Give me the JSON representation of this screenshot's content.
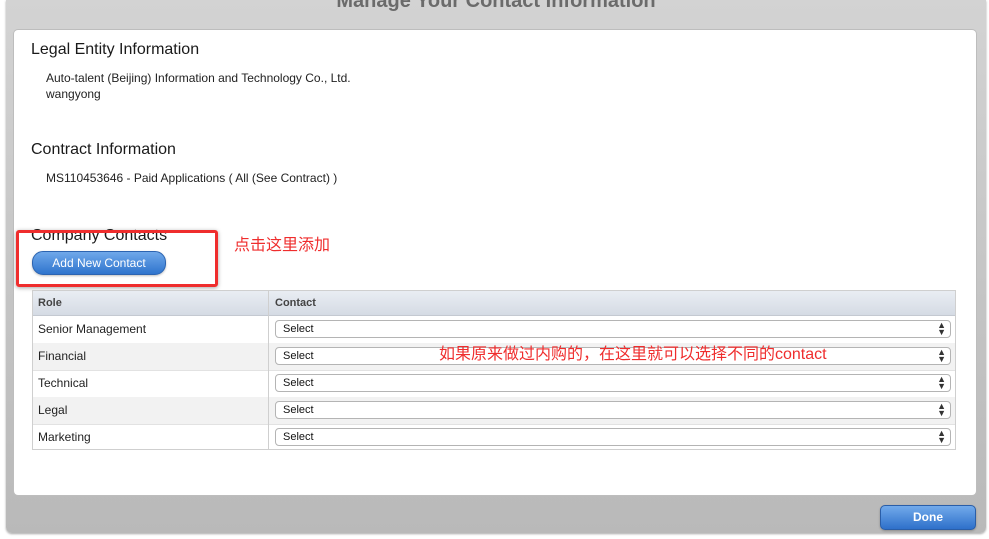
{
  "dialog": {
    "title": "Manage Your Contact Information",
    "done_label": "Done"
  },
  "legal_entity": {
    "heading": "Legal Entity Information",
    "name": "Auto-talent (Beijing) Information and Technology Co., Ltd.",
    "user": "wangyong"
  },
  "contract": {
    "heading": "Contract Information",
    "line": "MS110453646 - Paid Applications ( All (See Contract) )"
  },
  "company_contacts": {
    "heading": "Company Contacts",
    "add_label": "Add New Contact",
    "columns": [
      "Role",
      "Contact"
    ],
    "rows": [
      {
        "role": "Senior Management",
        "contact": "Select"
      },
      {
        "role": "Financial",
        "contact": "Select"
      },
      {
        "role": "Technical",
        "contact": "Select"
      },
      {
        "role": "Legal",
        "contact": "Select"
      },
      {
        "role": "Marketing",
        "contact": "Select"
      }
    ]
  },
  "annotations": {
    "add_hint": "点击这里添加",
    "select_hint": "如果原来做过内购的，在这里就可以选择不同的contact"
  },
  "colors": {
    "accent_blue": "#2f74cd",
    "annotation_red": "#ef2d2d"
  }
}
